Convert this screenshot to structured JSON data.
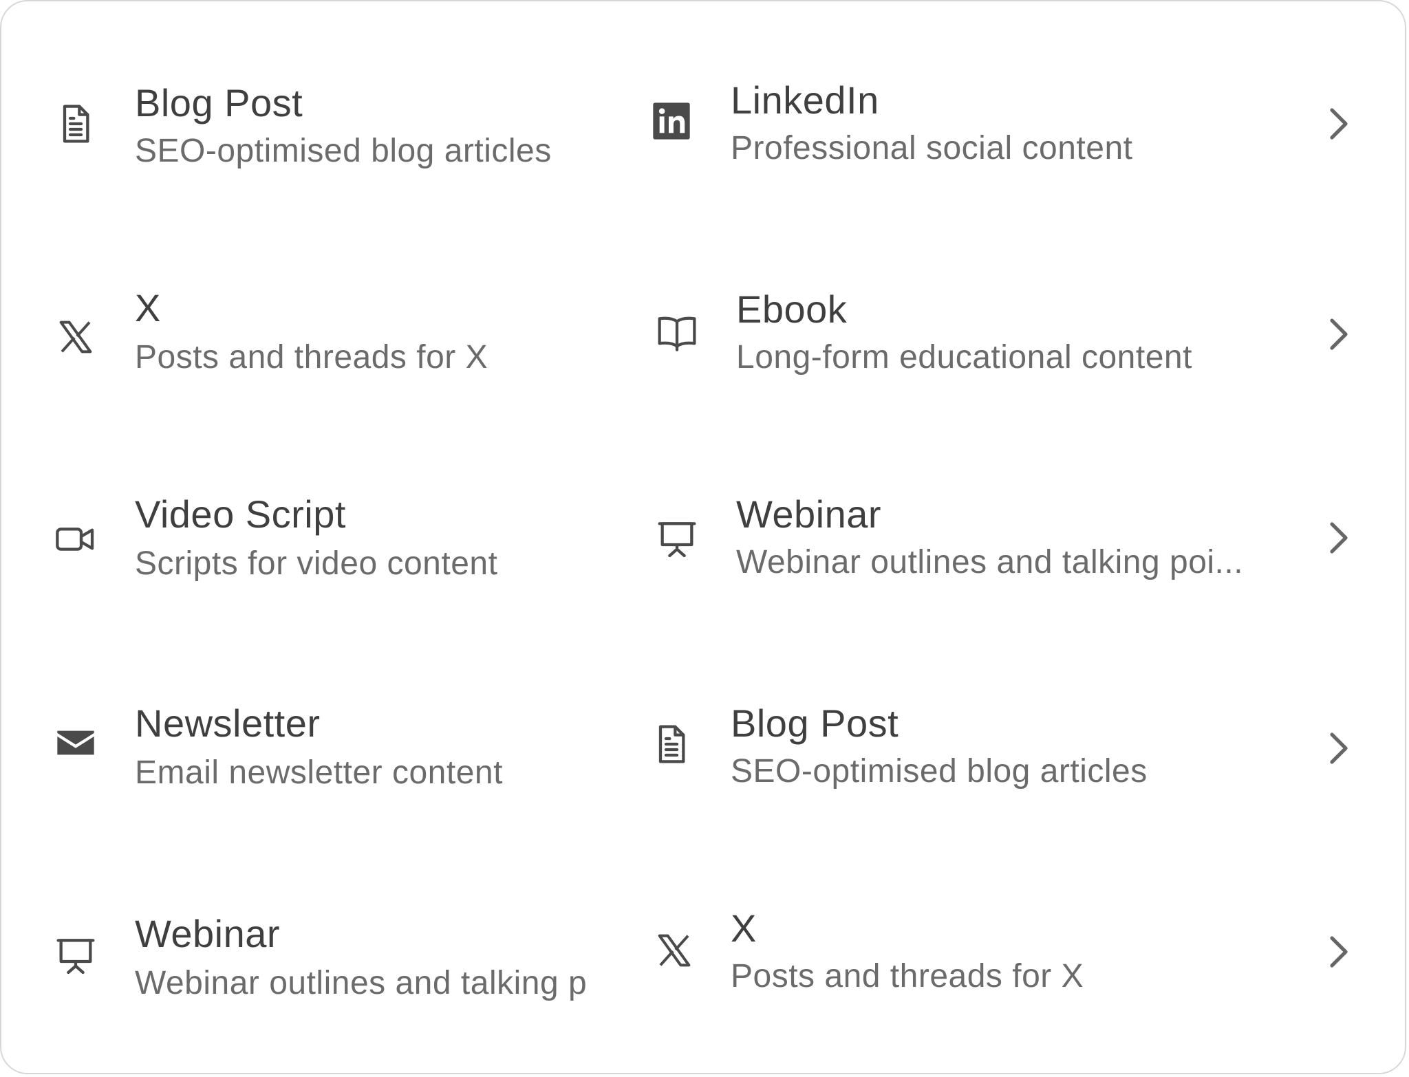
{
  "left_column": [
    {
      "title": "Blog Post",
      "description": "SEO-optimised blog articles",
      "icon": "document-icon"
    },
    {
      "title": "X",
      "description": "Posts and threads for X",
      "icon": "x-logo-icon"
    },
    {
      "title": "Video Script",
      "description": "Scripts for video content",
      "icon": "video-camera-icon"
    },
    {
      "title": "Newsletter",
      "description": "Email newsletter content",
      "icon": "envelope-icon"
    },
    {
      "title": "Webinar",
      "description": "Webinar outlines and talking p",
      "icon": "presentation-icon"
    }
  ],
  "right_column": [
    {
      "title": "LinkedIn",
      "description": "Professional social content",
      "icon": "linkedin-icon"
    },
    {
      "title": "Ebook",
      "description": "Long-form educational content",
      "icon": "book-icon"
    },
    {
      "title": "Webinar",
      "description": "Webinar outlines and talking poi...",
      "icon": "presentation-icon"
    },
    {
      "title": "Blog Post",
      "description": "SEO-optimised blog articles",
      "icon": "document-icon"
    },
    {
      "title": "X",
      "description": "Posts and threads for X",
      "icon": "x-logo-icon"
    }
  ],
  "colors": {
    "title": "#3f3f3f",
    "description": "#6b6b6b",
    "icon": "#4a4a4a",
    "border": "#d7d7d7"
  }
}
